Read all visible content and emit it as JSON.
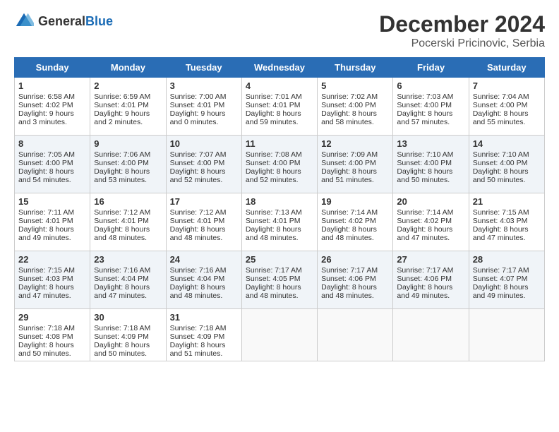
{
  "header": {
    "logo_general": "General",
    "logo_blue": "Blue",
    "month": "December 2024",
    "location": "Pocerski Pricinovic, Serbia"
  },
  "days_of_week": [
    "Sunday",
    "Monday",
    "Tuesday",
    "Wednesday",
    "Thursday",
    "Friday",
    "Saturday"
  ],
  "weeks": [
    [
      {
        "day": "1",
        "sunrise": "6:58 AM",
        "sunset": "4:02 PM",
        "daylight": "9 hours and 3 minutes."
      },
      {
        "day": "2",
        "sunrise": "6:59 AM",
        "sunset": "4:01 PM",
        "daylight": "9 hours and 2 minutes."
      },
      {
        "day": "3",
        "sunrise": "7:00 AM",
        "sunset": "4:01 PM",
        "daylight": "9 hours and 0 minutes."
      },
      {
        "day": "4",
        "sunrise": "7:01 AM",
        "sunset": "4:01 PM",
        "daylight": "8 hours and 59 minutes."
      },
      {
        "day": "5",
        "sunrise": "7:02 AM",
        "sunset": "4:00 PM",
        "daylight": "8 hours and 58 minutes."
      },
      {
        "day": "6",
        "sunrise": "7:03 AM",
        "sunset": "4:00 PM",
        "daylight": "8 hours and 57 minutes."
      },
      {
        "day": "7",
        "sunrise": "7:04 AM",
        "sunset": "4:00 PM",
        "daylight": "8 hours and 55 minutes."
      }
    ],
    [
      {
        "day": "8",
        "sunrise": "7:05 AM",
        "sunset": "4:00 PM",
        "daylight": "8 hours and 54 minutes."
      },
      {
        "day": "9",
        "sunrise": "7:06 AM",
        "sunset": "4:00 PM",
        "daylight": "8 hours and 53 minutes."
      },
      {
        "day": "10",
        "sunrise": "7:07 AM",
        "sunset": "4:00 PM",
        "daylight": "8 hours and 52 minutes."
      },
      {
        "day": "11",
        "sunrise": "7:08 AM",
        "sunset": "4:00 PM",
        "daylight": "8 hours and 52 minutes."
      },
      {
        "day": "12",
        "sunrise": "7:09 AM",
        "sunset": "4:00 PM",
        "daylight": "8 hours and 51 minutes."
      },
      {
        "day": "13",
        "sunrise": "7:10 AM",
        "sunset": "4:00 PM",
        "daylight": "8 hours and 50 minutes."
      },
      {
        "day": "14",
        "sunrise": "7:10 AM",
        "sunset": "4:00 PM",
        "daylight": "8 hours and 50 minutes."
      }
    ],
    [
      {
        "day": "15",
        "sunrise": "7:11 AM",
        "sunset": "4:01 PM",
        "daylight": "8 hours and 49 minutes."
      },
      {
        "day": "16",
        "sunrise": "7:12 AM",
        "sunset": "4:01 PM",
        "daylight": "8 hours and 48 minutes."
      },
      {
        "day": "17",
        "sunrise": "7:12 AM",
        "sunset": "4:01 PM",
        "daylight": "8 hours and 48 minutes."
      },
      {
        "day": "18",
        "sunrise": "7:13 AM",
        "sunset": "4:01 PM",
        "daylight": "8 hours and 48 minutes."
      },
      {
        "day": "19",
        "sunrise": "7:14 AM",
        "sunset": "4:02 PM",
        "daylight": "8 hours and 48 minutes."
      },
      {
        "day": "20",
        "sunrise": "7:14 AM",
        "sunset": "4:02 PM",
        "daylight": "8 hours and 47 minutes."
      },
      {
        "day": "21",
        "sunrise": "7:15 AM",
        "sunset": "4:03 PM",
        "daylight": "8 hours and 47 minutes."
      }
    ],
    [
      {
        "day": "22",
        "sunrise": "7:15 AM",
        "sunset": "4:03 PM",
        "daylight": "8 hours and 47 minutes."
      },
      {
        "day": "23",
        "sunrise": "7:16 AM",
        "sunset": "4:04 PM",
        "daylight": "8 hours and 47 minutes."
      },
      {
        "day": "24",
        "sunrise": "7:16 AM",
        "sunset": "4:04 PM",
        "daylight": "8 hours and 48 minutes."
      },
      {
        "day": "25",
        "sunrise": "7:17 AM",
        "sunset": "4:05 PM",
        "daylight": "8 hours and 48 minutes."
      },
      {
        "day": "26",
        "sunrise": "7:17 AM",
        "sunset": "4:06 PM",
        "daylight": "8 hours and 48 minutes."
      },
      {
        "day": "27",
        "sunrise": "7:17 AM",
        "sunset": "4:06 PM",
        "daylight": "8 hours and 49 minutes."
      },
      {
        "day": "28",
        "sunrise": "7:17 AM",
        "sunset": "4:07 PM",
        "daylight": "8 hours and 49 minutes."
      }
    ],
    [
      {
        "day": "29",
        "sunrise": "7:18 AM",
        "sunset": "4:08 PM",
        "daylight": "8 hours and 50 minutes."
      },
      {
        "day": "30",
        "sunrise": "7:18 AM",
        "sunset": "4:09 PM",
        "daylight": "8 hours and 50 minutes."
      },
      {
        "day": "31",
        "sunrise": "7:18 AM",
        "sunset": "4:09 PM",
        "daylight": "8 hours and 51 minutes."
      },
      null,
      null,
      null,
      null
    ]
  ]
}
